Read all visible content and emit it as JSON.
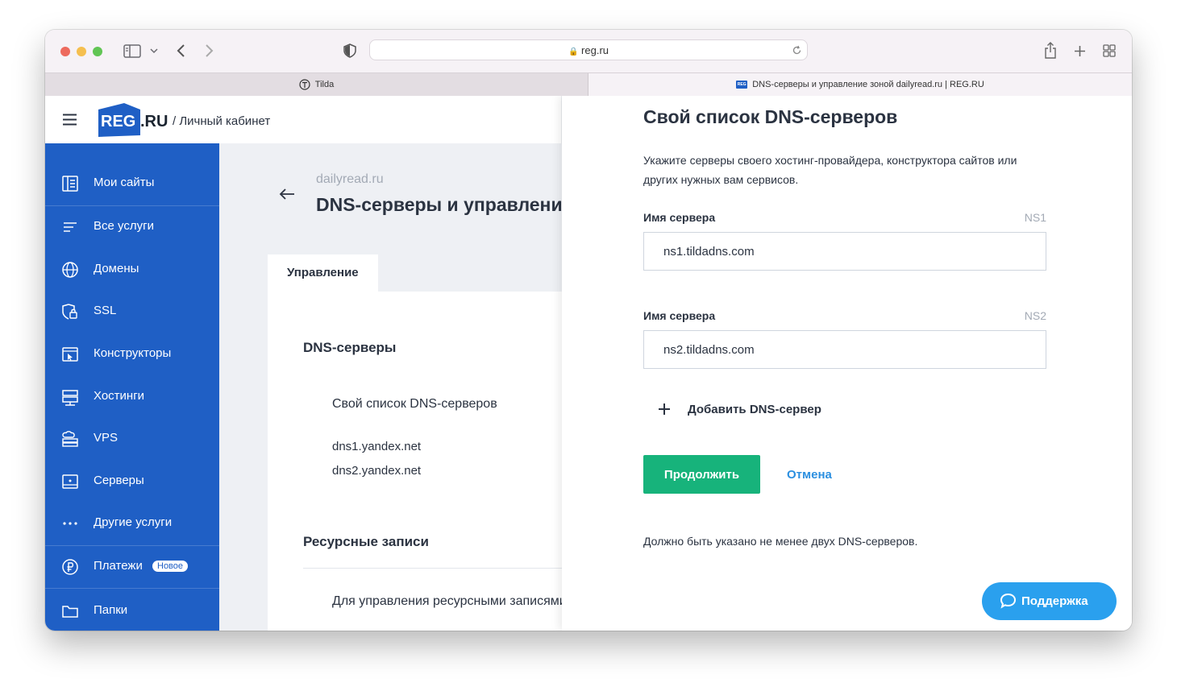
{
  "browser": {
    "address": "reg.ru",
    "tabs": [
      {
        "label": "Tilda",
        "active": false
      },
      {
        "label": "DNS-серверы и управление зоной dailyread.ru | REG.RU",
        "active": true
      }
    ]
  },
  "header": {
    "logo_main": "REG",
    "logo_suffix": ".RU",
    "cabinet_label": "/ Личный кабинет"
  },
  "sidebar": {
    "items": [
      {
        "label": "Мои сайты",
        "icon": "sites-icon"
      },
      {
        "label": "Все услуги",
        "icon": "list-icon"
      },
      {
        "label": "Домены",
        "icon": "globe-icon"
      },
      {
        "label": "SSL",
        "icon": "shield-lock-icon"
      },
      {
        "label": "Конструкторы",
        "icon": "builder-icon"
      },
      {
        "label": "Хостинги",
        "icon": "hosting-icon"
      },
      {
        "label": "VPS",
        "icon": "cloud-server-icon"
      },
      {
        "label": "Серверы",
        "icon": "server-icon"
      },
      {
        "label": "Другие услуги",
        "icon": "more-icon"
      },
      {
        "label": "Платежи",
        "icon": "ruble-icon",
        "badge": "Новое"
      },
      {
        "label": "Папки",
        "icon": "folder-icon"
      }
    ]
  },
  "main": {
    "breadcrumb": "dailyread.ru",
    "title": "DNS-серверы и управление зоной",
    "tab_label": "Управление",
    "dns_section_title": "DNS-серверы",
    "dns_list_title": "Свой список DNS-серверов",
    "dns_servers": [
      "dns1.yandex.net",
      "dns2.yandex.net"
    ],
    "records_title": "Ресурсные записи",
    "records_text": "Для управления ресурсными записями"
  },
  "drawer": {
    "title": "Свой список DNS-серверов",
    "description_line1": "Укажите серверы своего хостинг-провайдера, конструктора сайтов или",
    "description_line2": "других нужных вам сервисов.",
    "fields": [
      {
        "label": "Имя сервера",
        "tag": "NS1",
        "value": "ns1.tildadns.com"
      },
      {
        "label": "Имя сервера",
        "tag": "NS2",
        "value": "ns2.tildadns.com"
      }
    ],
    "add_label": "Добавить DNS-сервер",
    "continue_label": "Продолжить",
    "cancel_label": "Отмена",
    "note": "Должно быть указано не менее двух DNS-серверов."
  },
  "support_label": "Поддержка",
  "colors": {
    "sidebar": "#1f5fc5",
    "primary_button": "#17b37b",
    "link": "#2b8fe0",
    "support": "#2aa0ee"
  }
}
